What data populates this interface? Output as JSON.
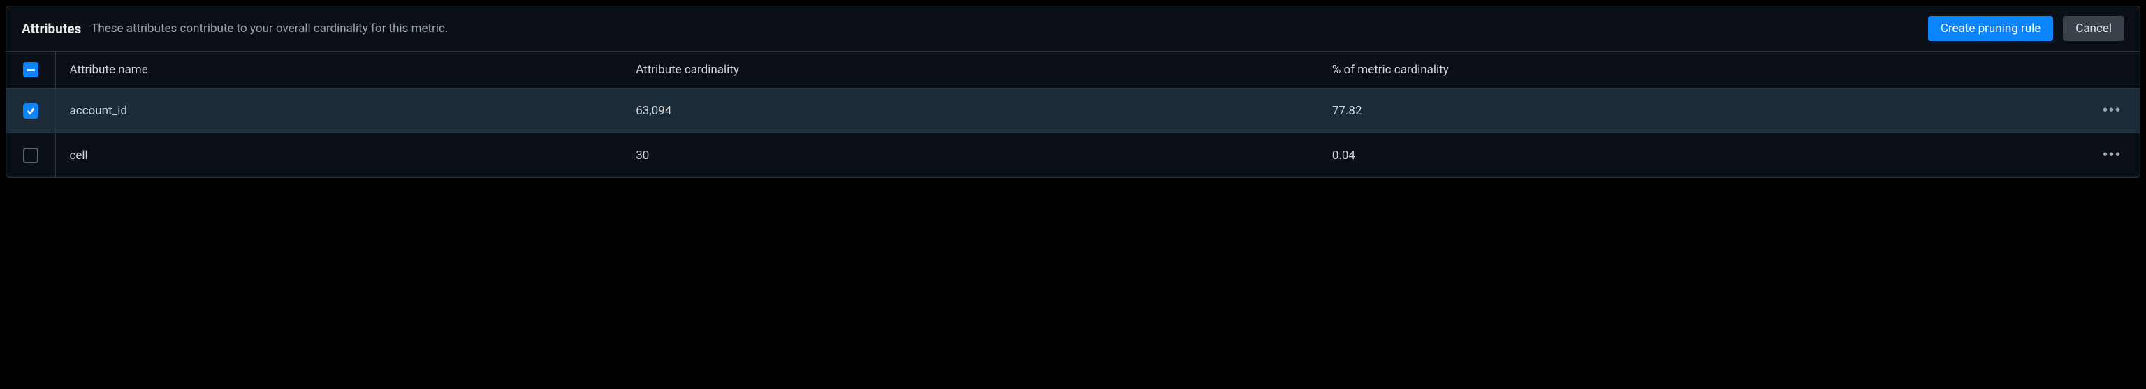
{
  "header": {
    "title": "Attributes",
    "subtitle": "These attributes contribute to your overall cardinality for this metric.",
    "create_label": "Create pruning rule",
    "cancel_label": "Cancel"
  },
  "columns": {
    "name": "Attribute name",
    "cardinality": "Attribute cardinality",
    "percent": "% of metric cardinality"
  },
  "rows": [
    {
      "selected": true,
      "name": "account_id",
      "cardinality": "63,094",
      "percent": "77.82"
    },
    {
      "selected": false,
      "name": "cell",
      "cardinality": "30",
      "percent": "0.04"
    }
  ],
  "select_all_state": "indeterminate"
}
